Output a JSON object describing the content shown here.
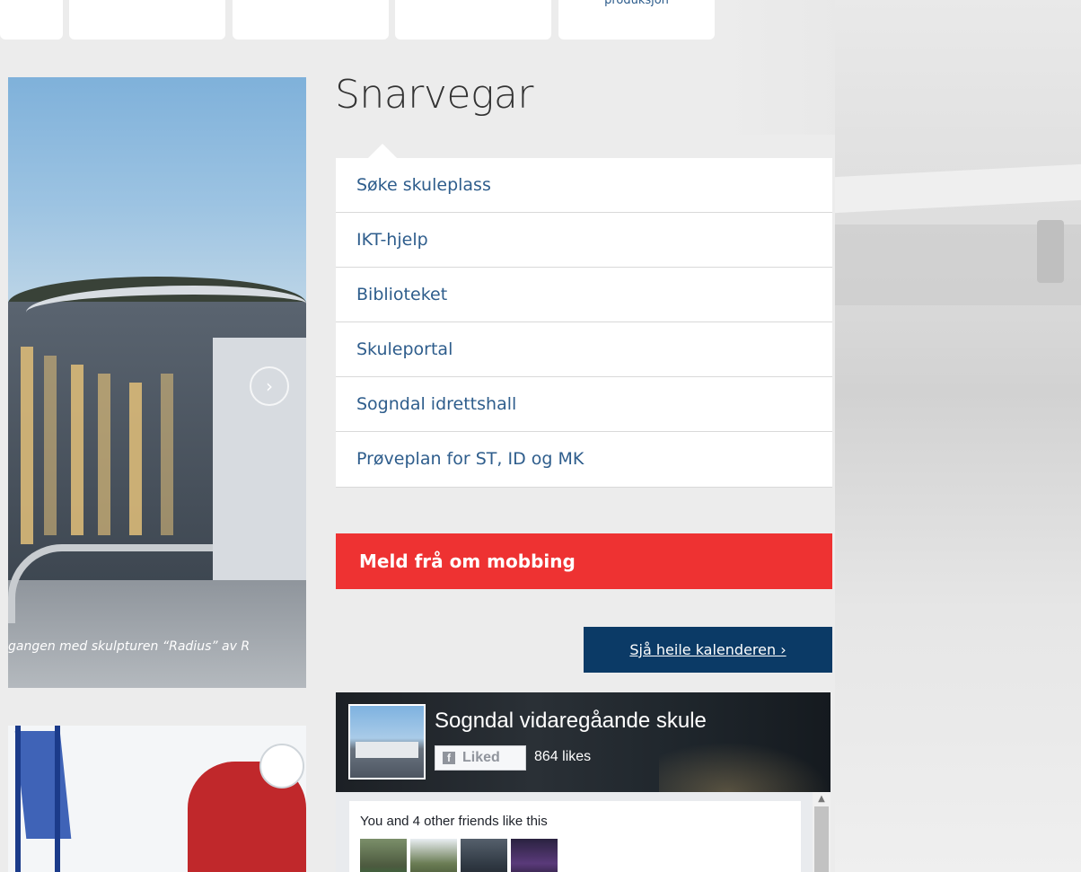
{
  "top_nav": {
    "tabs": [
      {
        "label": ""
      },
      {
        "label": ""
      },
      {
        "label": ""
      },
      {
        "label": ""
      },
      {
        "label": "produksjon"
      }
    ]
  },
  "carousel": {
    "caption": "gangen med skulpturen “Radius” av R",
    "next_icon": "chevron-right-icon"
  },
  "shortcuts": {
    "title": "Snarvegar",
    "items": [
      {
        "label": "Søke skuleplass"
      },
      {
        "label": "IKT-hjelp"
      },
      {
        "label": "Biblioteket"
      },
      {
        "label": "Skuleportal"
      },
      {
        "label": "Sogndal idrettshall"
      },
      {
        "label": "Prøveplan for ST, ID og MK"
      }
    ]
  },
  "report_bullying": {
    "label": "Meld frå om mobbing",
    "color": "#ee3232"
  },
  "calendar": {
    "label": "Sjå heile kalenderen ›",
    "color": "#0b3a66"
  },
  "facebook": {
    "page_name": "Sogndal vidaregåande skule",
    "liked_label": "Liked",
    "likes": "864 likes",
    "friends_text": "You and 4 other friends like this",
    "icon": "facebook-icon"
  },
  "colors": {
    "accent_link": "#2e5d8c",
    "background": "#ececec"
  }
}
